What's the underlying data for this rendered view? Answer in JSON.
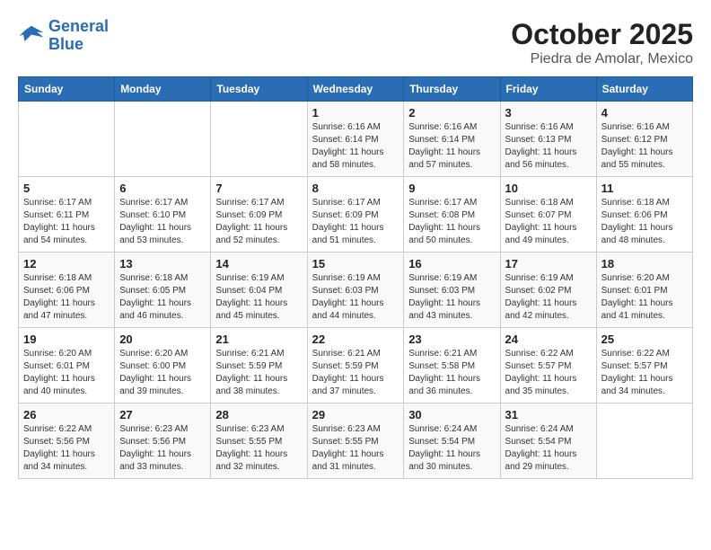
{
  "logo": {
    "line1": "General",
    "line2": "Blue"
  },
  "title": "October 2025",
  "subtitle": "Piedra de Amolar, Mexico",
  "weekdays": [
    "Sunday",
    "Monday",
    "Tuesday",
    "Wednesday",
    "Thursday",
    "Friday",
    "Saturday"
  ],
  "weeks": [
    [
      {
        "day": "",
        "info": ""
      },
      {
        "day": "",
        "info": ""
      },
      {
        "day": "",
        "info": ""
      },
      {
        "day": "1",
        "info": "Sunrise: 6:16 AM\nSunset: 6:14 PM\nDaylight: 11 hours\nand 58 minutes."
      },
      {
        "day": "2",
        "info": "Sunrise: 6:16 AM\nSunset: 6:14 PM\nDaylight: 11 hours\nand 57 minutes."
      },
      {
        "day": "3",
        "info": "Sunrise: 6:16 AM\nSunset: 6:13 PM\nDaylight: 11 hours\nand 56 minutes."
      },
      {
        "day": "4",
        "info": "Sunrise: 6:16 AM\nSunset: 6:12 PM\nDaylight: 11 hours\nand 55 minutes."
      }
    ],
    [
      {
        "day": "5",
        "info": "Sunrise: 6:17 AM\nSunset: 6:11 PM\nDaylight: 11 hours\nand 54 minutes."
      },
      {
        "day": "6",
        "info": "Sunrise: 6:17 AM\nSunset: 6:10 PM\nDaylight: 11 hours\nand 53 minutes."
      },
      {
        "day": "7",
        "info": "Sunrise: 6:17 AM\nSunset: 6:09 PM\nDaylight: 11 hours\nand 52 minutes."
      },
      {
        "day": "8",
        "info": "Sunrise: 6:17 AM\nSunset: 6:09 PM\nDaylight: 11 hours\nand 51 minutes."
      },
      {
        "day": "9",
        "info": "Sunrise: 6:17 AM\nSunset: 6:08 PM\nDaylight: 11 hours\nand 50 minutes."
      },
      {
        "day": "10",
        "info": "Sunrise: 6:18 AM\nSunset: 6:07 PM\nDaylight: 11 hours\nand 49 minutes."
      },
      {
        "day": "11",
        "info": "Sunrise: 6:18 AM\nSunset: 6:06 PM\nDaylight: 11 hours\nand 48 minutes."
      }
    ],
    [
      {
        "day": "12",
        "info": "Sunrise: 6:18 AM\nSunset: 6:06 PM\nDaylight: 11 hours\nand 47 minutes."
      },
      {
        "day": "13",
        "info": "Sunrise: 6:18 AM\nSunset: 6:05 PM\nDaylight: 11 hours\nand 46 minutes."
      },
      {
        "day": "14",
        "info": "Sunrise: 6:19 AM\nSunset: 6:04 PM\nDaylight: 11 hours\nand 45 minutes."
      },
      {
        "day": "15",
        "info": "Sunrise: 6:19 AM\nSunset: 6:03 PM\nDaylight: 11 hours\nand 44 minutes."
      },
      {
        "day": "16",
        "info": "Sunrise: 6:19 AM\nSunset: 6:03 PM\nDaylight: 11 hours\nand 43 minutes."
      },
      {
        "day": "17",
        "info": "Sunrise: 6:19 AM\nSunset: 6:02 PM\nDaylight: 11 hours\nand 42 minutes."
      },
      {
        "day": "18",
        "info": "Sunrise: 6:20 AM\nSunset: 6:01 PM\nDaylight: 11 hours\nand 41 minutes."
      }
    ],
    [
      {
        "day": "19",
        "info": "Sunrise: 6:20 AM\nSunset: 6:01 PM\nDaylight: 11 hours\nand 40 minutes."
      },
      {
        "day": "20",
        "info": "Sunrise: 6:20 AM\nSunset: 6:00 PM\nDaylight: 11 hours\nand 39 minutes."
      },
      {
        "day": "21",
        "info": "Sunrise: 6:21 AM\nSunset: 5:59 PM\nDaylight: 11 hours\nand 38 minutes."
      },
      {
        "day": "22",
        "info": "Sunrise: 6:21 AM\nSunset: 5:59 PM\nDaylight: 11 hours\nand 37 minutes."
      },
      {
        "day": "23",
        "info": "Sunrise: 6:21 AM\nSunset: 5:58 PM\nDaylight: 11 hours\nand 36 minutes."
      },
      {
        "day": "24",
        "info": "Sunrise: 6:22 AM\nSunset: 5:57 PM\nDaylight: 11 hours\nand 35 minutes."
      },
      {
        "day": "25",
        "info": "Sunrise: 6:22 AM\nSunset: 5:57 PM\nDaylight: 11 hours\nand 34 minutes."
      }
    ],
    [
      {
        "day": "26",
        "info": "Sunrise: 6:22 AM\nSunset: 5:56 PM\nDaylight: 11 hours\nand 34 minutes."
      },
      {
        "day": "27",
        "info": "Sunrise: 6:23 AM\nSunset: 5:56 PM\nDaylight: 11 hours\nand 33 minutes."
      },
      {
        "day": "28",
        "info": "Sunrise: 6:23 AM\nSunset: 5:55 PM\nDaylight: 11 hours\nand 32 minutes."
      },
      {
        "day": "29",
        "info": "Sunrise: 6:23 AM\nSunset: 5:55 PM\nDaylight: 11 hours\nand 31 minutes."
      },
      {
        "day": "30",
        "info": "Sunrise: 6:24 AM\nSunset: 5:54 PM\nDaylight: 11 hours\nand 30 minutes."
      },
      {
        "day": "31",
        "info": "Sunrise: 6:24 AM\nSunset: 5:54 PM\nDaylight: 11 hours\nand 29 minutes."
      },
      {
        "day": "",
        "info": ""
      }
    ]
  ]
}
